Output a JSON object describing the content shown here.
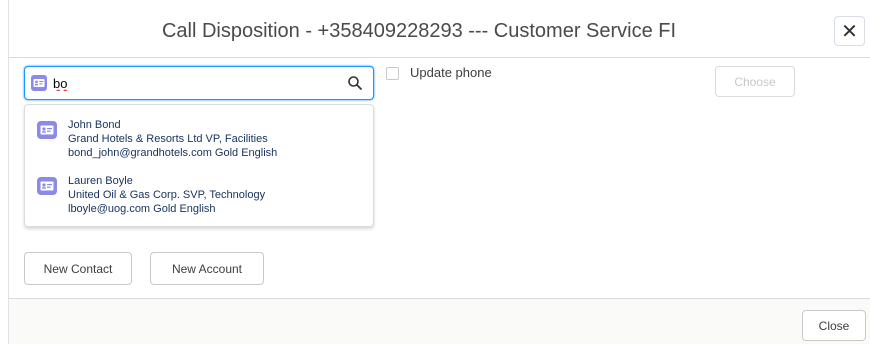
{
  "modal": {
    "title": "Call Disposition - +358409228293 --- Customer Service FI",
    "close_icon": "close-icon"
  },
  "search": {
    "value": "bo",
    "placeholder": "",
    "entity_icon": "contact-icon",
    "search_icon": "search-icon"
  },
  "results": [
    {
      "name": "John Bond",
      "line2": "Grand Hotels & Resorts Ltd VP, Facilities",
      "line3": "bond_john@grandhotels.com Gold English",
      "icon": "contact-card-icon"
    },
    {
      "name": "Lauren Boyle",
      "line2": "United Oil & Gas Corp. SVP, Technology",
      "line3": "lboyle@uog.com Gold English",
      "icon": "contact-card-icon"
    }
  ],
  "update_phone": {
    "label": "Update phone",
    "checked": false
  },
  "buttons": {
    "choose": "Choose",
    "new_contact": "New Contact",
    "new_account": "New Account",
    "close": "Close"
  },
  "colors": {
    "accent": "#1b96ff",
    "contact_badge": "#8b8ae6"
  }
}
